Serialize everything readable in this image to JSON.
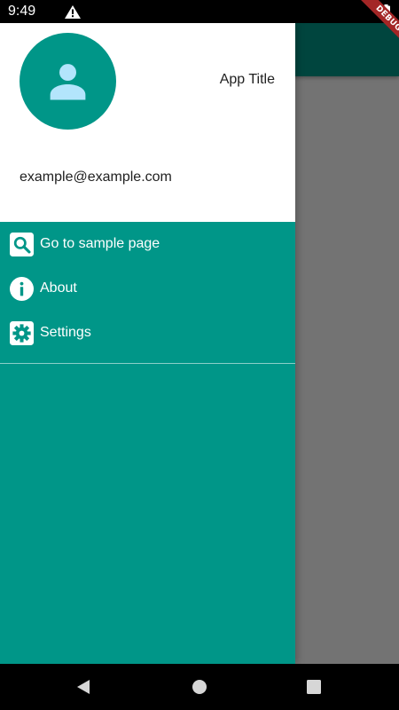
{
  "status_bar": {
    "time": "9:49",
    "icons": [
      "warning-icon",
      "battery-icon"
    ]
  },
  "debug_banner": {
    "label": "DEBUG"
  },
  "drawer": {
    "header": {
      "account_name": "App Title",
      "account_email": "example@example.com",
      "avatar_icon": "person-icon"
    },
    "items": [
      {
        "label": "Go to sample page",
        "icon": "search-icon"
      },
      {
        "label": "About",
        "icon": "info-icon"
      },
      {
        "label": "Settings",
        "icon": "settings-icon"
      }
    ]
  },
  "nav_bar": {
    "buttons": [
      "back-icon",
      "home-icon",
      "recents-icon"
    ]
  },
  "colors": {
    "primary": "#009688",
    "header_background": "#ffffff",
    "avatar_glyph": "#b3e5fc",
    "scrim": "#787878",
    "debug_banner": "#a32626"
  }
}
